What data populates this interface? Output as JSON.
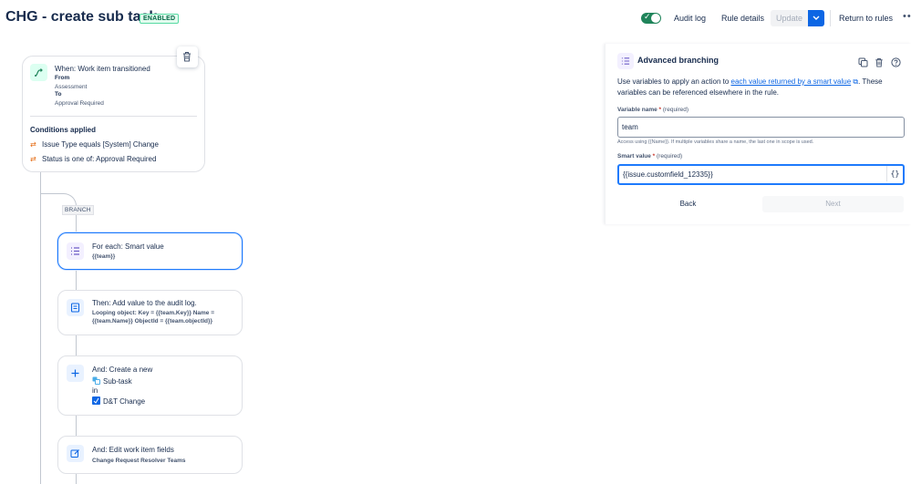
{
  "header": {
    "title": "CHG - create sub task",
    "status_badge": "ENABLED",
    "audit_log": "Audit log",
    "rule_details": "Rule details",
    "update": "Update",
    "return_to_rules": "Return to rules",
    "more": "•••"
  },
  "trigger": {
    "title": "When: Work item transitioned",
    "from_label": "From",
    "from_value": "Assessment",
    "to_label": "To",
    "to_value": "Approval Required",
    "conditions_title": "Conditions applied",
    "conditions": [
      "Issue Type equals [System] Change",
      "Status is one of: Approval Required"
    ]
  },
  "branch_label": "BRANCH",
  "components": [
    {
      "title": "For each: Smart value",
      "detail": "{{team}}"
    },
    {
      "title": "Then: Add value to the audit log.",
      "detail_line1": "Looping object: Key = {{team.Key}} Name =",
      "detail_line2": "{{team.Name}} ObjectId = {{team.objectId}}"
    },
    {
      "title": "And: Create a new",
      "line1": "Sub-task",
      "line2": "in",
      "line3": "D&T Change"
    },
    {
      "title": "And: Edit work item fields",
      "detail": "Change Request Resolver Teams"
    }
  ],
  "panel": {
    "title": "Advanced branching",
    "desc_prefix": "Use variables to apply an action to ",
    "desc_link": "each value returned by a smart value",
    "desc_suffix": ". These variables can be referenced elsewhere in the rule.",
    "variable_label": "Variable name",
    "required_marker": "*",
    "required_text": "(required)",
    "variable_value": "team",
    "variable_help": "Access using {{Name}}. If multiple variables share a name, the last one in scope is used.",
    "smart_label": "Smart value",
    "smart_value": "{{issue.customfield_12335}}",
    "braces": "{}",
    "back": "Back",
    "next": "Next"
  },
  "colors": {
    "accent": "#1d7afc",
    "enabled_green": "#1f845a",
    "condition_orange": "#e56910"
  }
}
